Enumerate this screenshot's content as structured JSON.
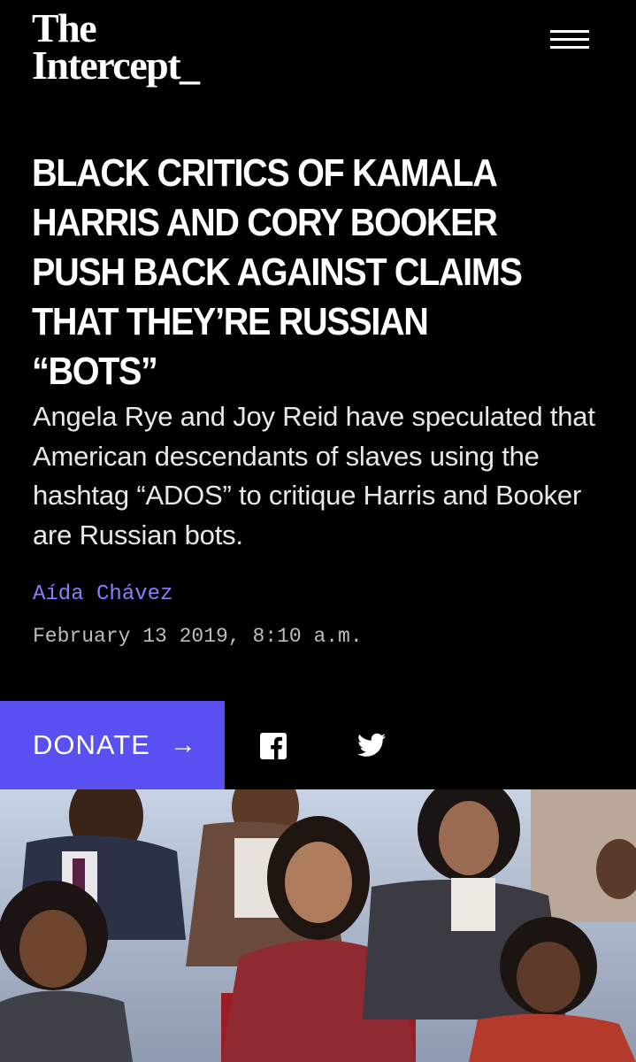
{
  "brand": {
    "line1": "The",
    "line2": "Intercept_"
  },
  "header": {
    "menu_icon": "hamburger-menu-icon"
  },
  "article": {
    "headline": "Black Critics of Kamala Harris and Cory Booker Push Back Against Claims That They’re Russian “Bots”",
    "dek": "Angela Rye and Joy Reid have speculated that American descendants of slaves using the hashtag “ADOS” to critique Harris and Booker are Russian bots.",
    "author": "Aída Chávez",
    "date": "February 13 2019, 8:10 a.m."
  },
  "share": {
    "donate_label": "DONATE",
    "donate_arrow": "→",
    "facebook_icon": "facebook-icon",
    "twitter_icon": "twitter-icon"
  },
  "colors": {
    "background": "#000000",
    "accent": "#5a4ff0",
    "byline": "#8a7dff",
    "text": "#ffffff",
    "date": "#bdbdbd"
  }
}
